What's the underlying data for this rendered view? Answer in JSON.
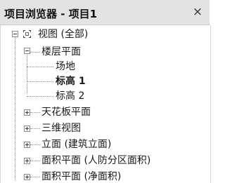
{
  "panel": {
    "title": "项目浏览器 - 项目1",
    "close_label": "×"
  },
  "tree": {
    "root": {
      "label": "视图 (全部)",
      "icon": "views-icon",
      "expanded": true
    },
    "floor_plans": {
      "label": "楼层平面",
      "expanded": true
    },
    "floor_plan_items": [
      {
        "label": "场地",
        "bold": false
      },
      {
        "label": "标高 1",
        "bold": true
      },
      {
        "label": "标高 2",
        "bold": false
      }
    ],
    "collapsed_groups": [
      {
        "label": "天花板平面"
      },
      {
        "label": "三维视图"
      },
      {
        "label": "立面 (建筑立面)"
      },
      {
        "label": "面积平面 (人防分区面积)"
      },
      {
        "label": "面积平面 (净面积)"
      }
    ]
  }
}
